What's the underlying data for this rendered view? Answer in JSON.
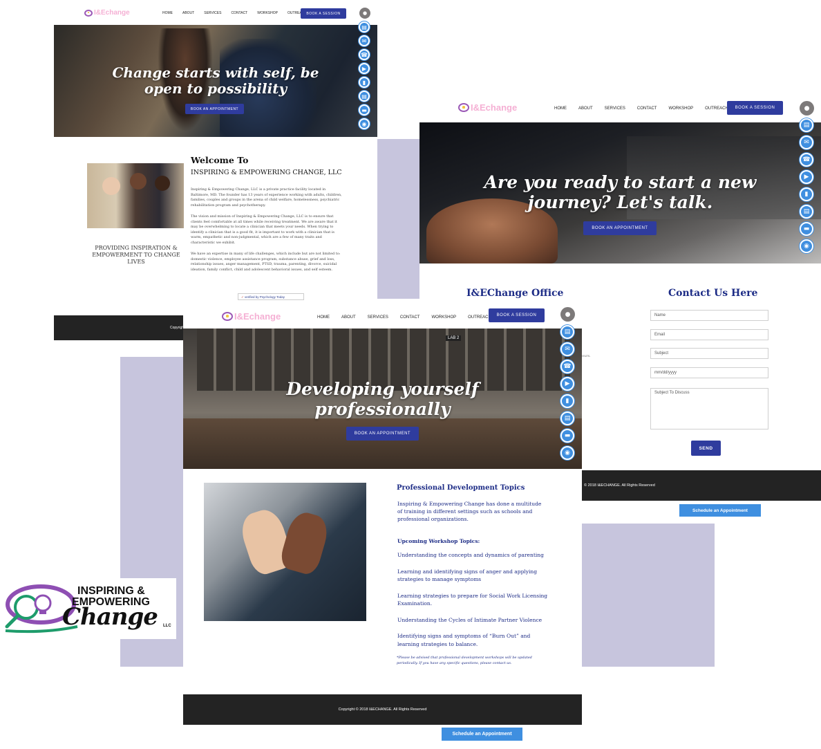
{
  "colors": {
    "accent": "#2f3c9e",
    "rail": "#3f8fe0",
    "lavender": "#c7c5dd",
    "footer": "#232323"
  },
  "nav": {
    "brand": "I&Echange",
    "links": [
      "HOME",
      "ABOUT",
      "SERVICES",
      "CONTACT",
      "WORKSHOP",
      "OUTREACH"
    ],
    "book": "BOOK A SESSION"
  },
  "rail_icons": [
    "news-icon",
    "mail-icon",
    "phone-icon",
    "play-icon",
    "bookmark-icon",
    "document-icon",
    "card-icon",
    "location-icon"
  ],
  "panel1": {
    "hero_title_1": "Change starts with self, be",
    "hero_title_2": "open to possibility",
    "hero_button": "BOOK AN APPOINTMENT",
    "welcome": "Welcome To",
    "company": "INSPIRING & EMPOWERING CHANGE, LLC",
    "para1": "Inspiring & Empowering Change, LLC is a private practice facility located in Baltimore, MD. The founder has 13 years of experience working with adults, children, families, couples and groups in the arena of child welfare, homelessness, psychiatric rehabilitation program and psychotherapy.",
    "para2": "The vision and mission of Inspiring & Empowering Change, LLC is to ensure that clients feel comfortable at all times while receiving treatment. We are aware that it may be overwhelming to locate a clinician that meets your needs. When trying to identify a clinician that is a good fit, it is important to work with a clinician that is warm, empathetic and non-judgmental, which are a few of many traits and characteristic we exhibit.",
    "para3": "We have an expertise in many of life challenges, which include but are not limited to: domestic violence, employee assistance program, substance abuse, grief and loss, relationship issues, anger management, PTSD, trauma, parenting, divorce, suicidal ideation, family conflict, child and adolescent behavioral issues, and self esteem.",
    "tagline": "PROVIDING INSPIRATION & EMPOWERMENT TO CHANGE LIVES",
    "verified": "verified by Psychology Today",
    "footer": "Copyrigh"
  },
  "panel2": {
    "brand": "I&Echange",
    "hero_title_1": "Are you ready to start a new",
    "hero_title_2": "journey? Let's talk.",
    "hero_button": "BOOK AN APPOINTMENT",
    "office_title": "I&EChange Office",
    "contact_title": "Contact Us Here",
    "fields": {
      "name": "Name",
      "email": "Email",
      "subject": "Subject",
      "date": "mm/dd/yyyy",
      "message": "Subject To Discuss"
    },
    "send": "SEND",
    "stray": "ours.",
    "footer": "© 2018 I&ECHANGE. All Rights Reserved",
    "schedule": "Schedule an Appointment"
  },
  "panel3": {
    "brand": "I&Echange",
    "hero_title_1": "Developing yourself",
    "hero_title_2": "professionally",
    "hero_button": "BOOK AN APPOINTMENT",
    "lab_sign": "LAB 2",
    "pd_title": "Professional Development Topics",
    "pd_intro": "Inspiring & Empowering Change has done a multitude of training in different settings such as schools and professional organizations.",
    "upcoming": "Upcoming Workshop Topics:",
    "topics": [
      "Understanding the concepts and dynamics of parenting",
      "Learning and identifying signs of anger and applying strategies to manage symptoms",
      "Learning strategies to prepare for Social Work Licensing Examination.",
      "Understanding the Cycles of Intimate Partner Violence",
      "Identifying signs and symptoms of “Burn Out” and learning strategies to balance."
    ],
    "note": "*Please be advised that professional development workshops will be updated periodically. If you have any specific questions, please contact us.",
    "footer": "Copyright © 2018 I&ECHANGE. All Rights Reserved",
    "schedule": "Schedule an Appointment"
  },
  "logo": {
    "line1": "INSPIRING &",
    "line2": "EMPOWERING",
    "line3": "Change",
    "llc": "LLC"
  }
}
